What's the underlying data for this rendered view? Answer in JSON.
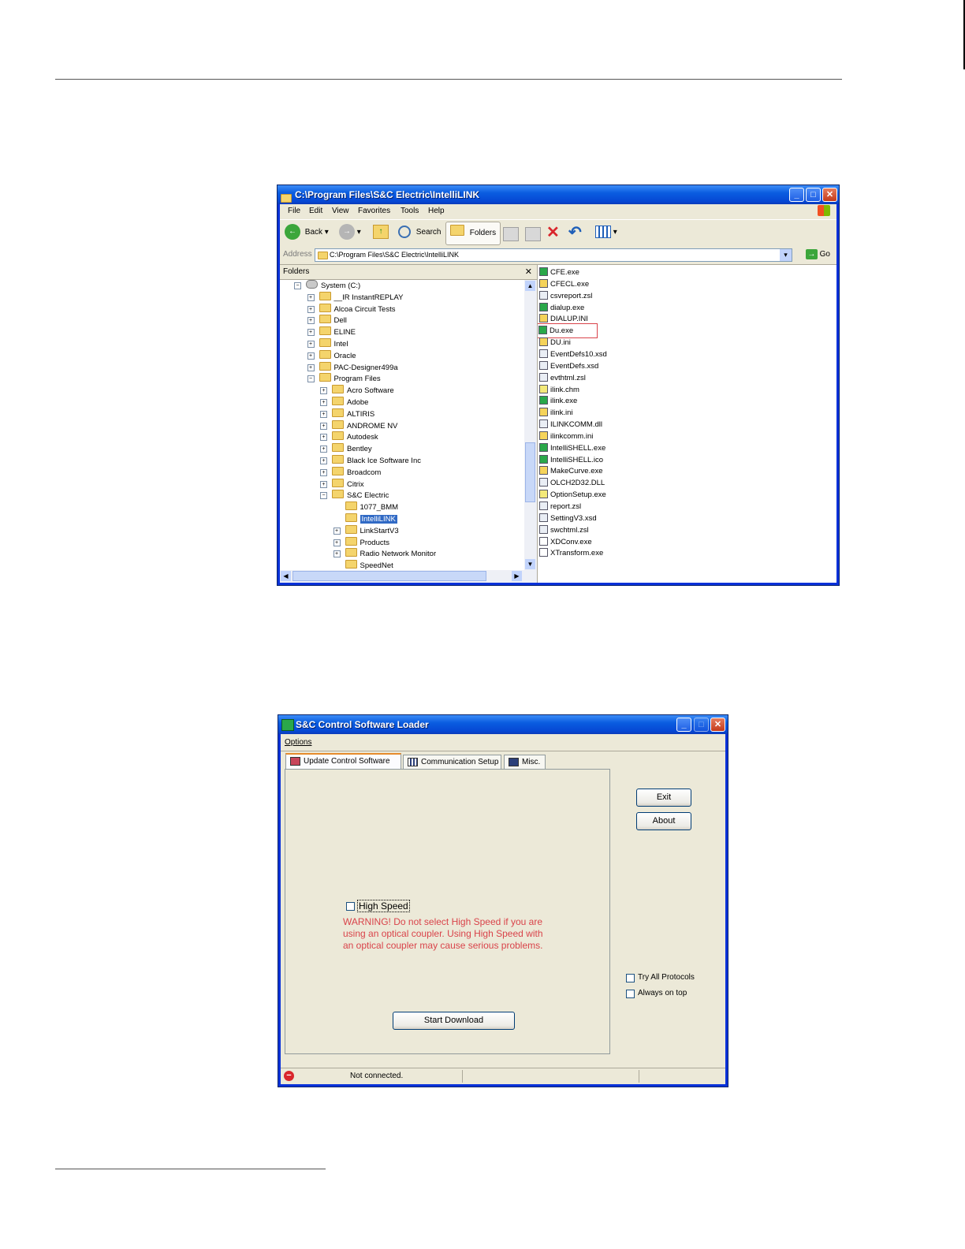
{
  "explorer": {
    "title": "C:\\Program Files\\S&C Electric\\IntelliLINK",
    "menu": [
      "File",
      "Edit",
      "View",
      "Favorites",
      "Tools",
      "Help"
    ],
    "toolbar": {
      "back": "Back",
      "search": "Search",
      "folders": "Folders"
    },
    "address_label": "Address",
    "address_value": "C:\\Program Files\\S&C Electric\\IntelliLINK",
    "go_label": "Go",
    "folders_header": "Folders",
    "tree": [
      {
        "label": "System (C:)",
        "level": 0,
        "toggle": "−"
      },
      {
        "label": "__IR InstantREPLAY",
        "level": 1,
        "toggle": "+"
      },
      {
        "label": "Alcoa Circuit Tests",
        "level": 1,
        "toggle": "+"
      },
      {
        "label": "Dell",
        "level": 1,
        "toggle": "+"
      },
      {
        "label": "ELINE",
        "level": 1,
        "toggle": "+"
      },
      {
        "label": "Intel",
        "level": 1,
        "toggle": "+"
      },
      {
        "label": "Oracle",
        "level": 1,
        "toggle": "+"
      },
      {
        "label": "PAC-Designer499a",
        "level": 1,
        "toggle": "+"
      },
      {
        "label": "Program Files",
        "level": 1,
        "toggle": "−"
      },
      {
        "label": "Acro Software",
        "level": 2,
        "toggle": "+"
      },
      {
        "label": "Adobe",
        "level": 2,
        "toggle": "+"
      },
      {
        "label": "ALTIRIS",
        "level": 2,
        "toggle": "+"
      },
      {
        "label": "ANDROME NV",
        "level": 2,
        "toggle": "+"
      },
      {
        "label": "Autodesk",
        "level": 2,
        "toggle": "+"
      },
      {
        "label": "Bentley",
        "level": 2,
        "toggle": "+"
      },
      {
        "label": "Black Ice Software Inc",
        "level": 2,
        "toggle": "+"
      },
      {
        "label": "Broadcom",
        "level": 2,
        "toggle": "+"
      },
      {
        "label": "Citrix",
        "level": 2,
        "toggle": "+"
      },
      {
        "label": "S&C Electric",
        "level": 2,
        "toggle": "−"
      },
      {
        "label": "1077_BMM",
        "level": 3,
        "toggle": ""
      },
      {
        "label": "IntelliLINK",
        "level": 3,
        "toggle": "",
        "selected": true
      },
      {
        "label": "LinkStartV3",
        "level": 3,
        "toggle": "+"
      },
      {
        "label": "Products",
        "level": 3,
        "toggle": "+"
      },
      {
        "label": "Radio Network Monitor",
        "level": 3,
        "toggle": "+"
      },
      {
        "label": "SpeedNet",
        "level": 3,
        "toggle": ""
      }
    ],
    "files": [
      {
        "name": "CFE.exe",
        "kind": "exe"
      },
      {
        "name": "CFECL.exe",
        "kind": "cfg"
      },
      {
        "name": "csvreport.zsl",
        "kind": "doc"
      },
      {
        "name": "dialup.exe",
        "kind": "exe"
      },
      {
        "name": "DIALUP.INI",
        "kind": "cfg"
      },
      {
        "name": "Du.exe",
        "kind": "exe",
        "highlighted": true
      },
      {
        "name": "DU.ini",
        "kind": "cfg"
      },
      {
        "name": "EventDefs10.xsd",
        "kind": "doc"
      },
      {
        "name": "EventDefs.xsd",
        "kind": "doc"
      },
      {
        "name": "evthtml.zsl",
        "kind": "doc"
      },
      {
        "name": "ilink.chm",
        "kind": "chm"
      },
      {
        "name": "ilink.exe",
        "kind": "exe"
      },
      {
        "name": "ilink.ini",
        "kind": "cfg"
      },
      {
        "name": "ILINKCOMM.dll",
        "kind": "doc"
      },
      {
        "name": "ilinkcomm.ini",
        "kind": "cfg"
      },
      {
        "name": "IntelliSHELL.exe",
        "kind": "exe"
      },
      {
        "name": "IntelliSHELL.ico",
        "kind": "exe"
      },
      {
        "name": "MakeCurve.exe",
        "kind": "cfg"
      },
      {
        "name": "OLCH2D32.DLL",
        "kind": "doc"
      },
      {
        "name": "OptionSetup.exe",
        "kind": "chm"
      },
      {
        "name": "report.zsl",
        "kind": "doc"
      },
      {
        "name": "SettingV3.xsd",
        "kind": "doc"
      },
      {
        "name": "swchtml.zsl",
        "kind": "doc"
      },
      {
        "name": "XDConv.exe",
        "kind": "box"
      },
      {
        "name": "XTransform.exe",
        "kind": "box"
      }
    ],
    "colors": {
      "highlight_box": "#d9434a",
      "selection": "#316ac5"
    }
  },
  "loader": {
    "title": "S&C Control Software Loader",
    "menu_options": "Options",
    "tabs": [
      "Update Control Software",
      "Communication Setup",
      "Misc."
    ],
    "high_speed_label": "High Speed",
    "warning_lines": [
      "WARNING!  Do not select High Speed if you are",
      "using an optical coupler. Using High Speed with",
      "an optical coupler may cause serious problems."
    ],
    "start_download": "Start Download",
    "exit": "Exit",
    "about": "About",
    "try_all_protocols": "Try All Protocols",
    "always_on_top": "Always on top",
    "status_text": "Not connected.",
    "colors": {
      "warning": "#d9434a"
    }
  }
}
